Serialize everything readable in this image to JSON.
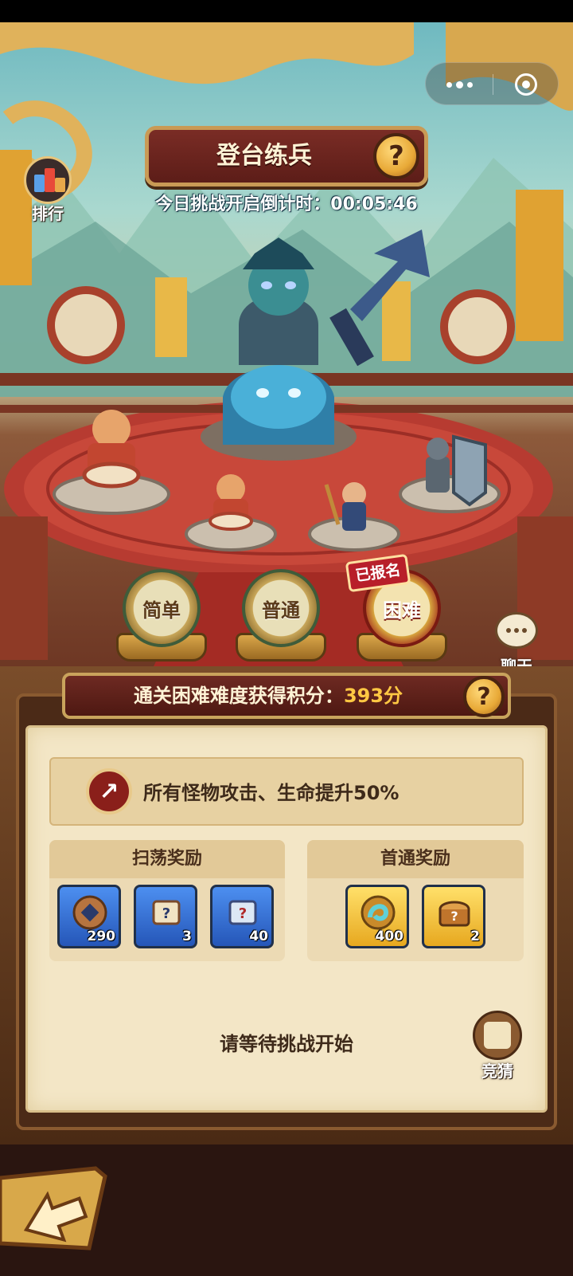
{
  "title": "登台练兵",
  "countdown": "今日挑战开启倒计时：00:05:46",
  "rank_label": "排行",
  "capsule": {
    "more_icon": "more-dots-icon",
    "close_icon": "close-target-icon"
  },
  "difficulties": [
    {
      "label": "简单",
      "selected": false
    },
    {
      "label": "普通",
      "selected": false
    },
    {
      "label": "困难",
      "selected": true
    }
  ],
  "signed_badge": "已报名",
  "chat_label": "聊天",
  "score_banner": {
    "prefix": "通关困难难度获得积分：",
    "score": "393分"
  },
  "buff_text": "所有怪物攻击、生命提升50%",
  "sweep_rewards": {
    "title": "扫荡奖励",
    "items": [
      {
        "icon": "copper-coin-icon",
        "count": "290"
      },
      {
        "icon": "mystery-scroll-icon",
        "count": "3"
      },
      {
        "icon": "blue-mystery-scroll-icon",
        "count": "40"
      }
    ]
  },
  "first_clear_rewards": {
    "title": "首通奖励",
    "items": [
      {
        "icon": "dragon-medal-icon",
        "count": "400"
      },
      {
        "icon": "mystery-chest-icon",
        "count": "2"
      }
    ]
  },
  "wait_text": "请等待挑战开始",
  "guess_label": "竞猜",
  "colors": {
    "accent_gold": "#ffc843",
    "banner_red": "#6e2a22",
    "paper": "#f3e6c6"
  }
}
